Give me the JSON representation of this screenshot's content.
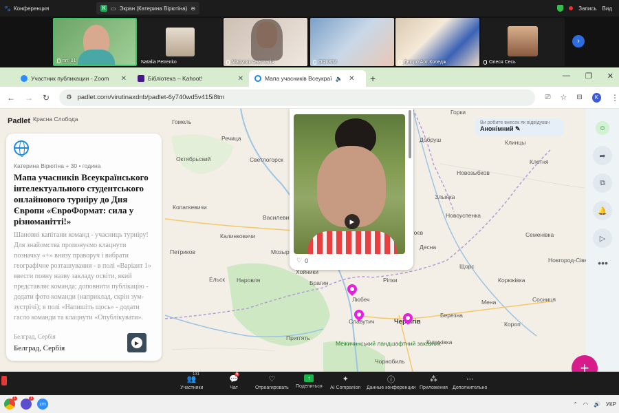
{
  "zoom": {
    "conference_label": "Конференция",
    "share_label": "Экран (Катерина Вірютіна)",
    "record_label": "Запись",
    "view_label": "Вид",
    "participants": [
      {
        "name": "nri_01"
      },
      {
        "name": "Natalia Petrenko"
      },
      {
        "name": "Марусик Анастасія"
      },
      {
        "name": "ОФККІМ"
      },
      {
        "name": "Дніпро Арт Коледж"
      },
      {
        "name": "Олеся Сесь"
      }
    ],
    "toolbar": {
      "participants_count": "131",
      "chat_badge": "5",
      "items": [
        "Участники",
        "Чат",
        "Отреагировать",
        "Поделиться",
        "AI Companion",
        "Данные конференции",
        "Приложения",
        "Дополнительно"
      ]
    }
  },
  "browser": {
    "tabs": [
      {
        "label": "Участник публикации - Zoom"
      },
      {
        "label": "Бібліотека – Kahoot!"
      },
      {
        "label": "Мапа учасників Всеукраї"
      }
    ],
    "url": "padlet.com/virutinaxdnb/padlet-6y740wd5v415i8tm",
    "profile_letter": "K"
  },
  "padlet": {
    "logo": "Padlet",
    "post": {
      "meta": "Катерина Вірютіна + 30 • година",
      "title": "Мапа учасників Всеукраїнського інтелектуального студентського онлайнового турніру до Дня Європи «ЄвроФормат: сила у різноманітті!»",
      "body": "Шановні капітани команд - учасниць турніру! Для знайомства пропонуємо клацнути позначку «+» внизу праворуч і вибрати географічне розташування - в полі «Варіант 1» ввести повну назву закладу освіти, який представляє команда; доповнити публікацію - додати фото команди (наприклад, скрін зум-зустрічі); в полі «Напишіть щось» - додати гасло команди та клацнути «Опублікувати».",
      "location_small": "Белград, Сербія",
      "location": "Белград, Сербія"
    },
    "video_likes": "0",
    "anon_hint": "Ви робите внесок як відвідувач",
    "anon_name": "Анонімний",
    "fab_label": "+"
  },
  "map_labels": {
    "a": "Красна Слобода",
    "b": "Гомель",
    "c": "Речица",
    "d": "Октябрьский",
    "e": "Светлогорск",
    "f": "Калинковичи",
    "g": "Мозырь",
    "h": "Ельск",
    "i": "Наровля",
    "j": "Брагин",
    "k": "Любеч",
    "l": "Славутич",
    "m": "Чернігів",
    "n": "Ріпки",
    "o": "Березна",
    "p": "Мена",
    "q": "Сосниця",
    "r": "Корюківка",
    "s": "Щорс",
    "t": "Новгород-Сіверський",
    "u": "Семенівка",
    "v": "Новозыбков",
    "w": "Клинцы",
    "x": "Добруш",
    "y": "Горки",
    "z": "Короп",
    "aa": "Куликівка",
    "ab": "Прип'ять",
    "ac": "Копаткевичи",
    "ad": "Петриков",
    "ae": "Василевичи",
    "af": "Злынка",
    "ag": "Клетня",
    "ah": "Новоуспенка",
    "ai": "Хойники",
    "aj": "Чорнобиль",
    "ak": "Межичинський ландшафтний заказник",
    "al": "Десна",
    "am": "Лоєв"
  },
  "taskbar": {
    "time_label": "УКР"
  }
}
